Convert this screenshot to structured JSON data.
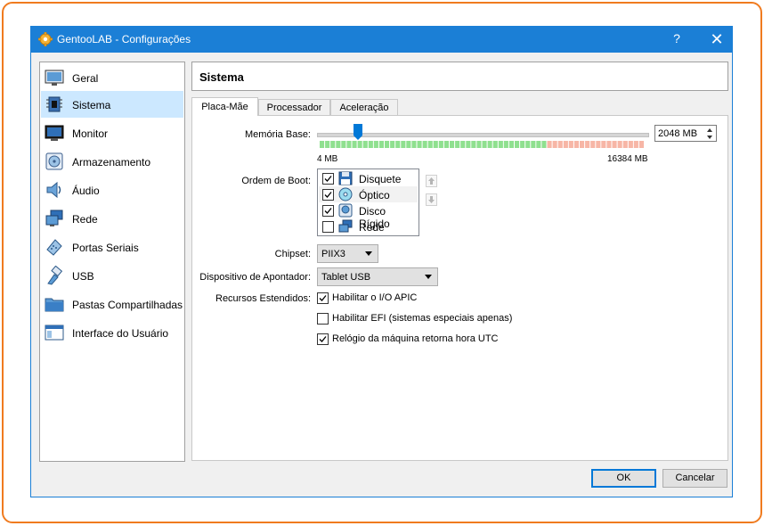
{
  "window": {
    "title": "GentooLAB - Configurações",
    "help_label": "?",
    "close_label": "✕"
  },
  "sidebar": {
    "items": [
      {
        "label": "Geral",
        "icon": "monitor-general-icon"
      },
      {
        "label": "Sistema",
        "icon": "chip-icon",
        "selected": true
      },
      {
        "label": "Monitor",
        "icon": "display-icon"
      },
      {
        "label": "Armazenamento",
        "icon": "disk-icon"
      },
      {
        "label": "Áudio",
        "icon": "speaker-icon"
      },
      {
        "label": "Rede",
        "icon": "network-icon"
      },
      {
        "label": "Portas Seriais",
        "icon": "serial-port-icon"
      },
      {
        "label": "USB",
        "icon": "usb-icon"
      },
      {
        "label": "Pastas Compartilhadas",
        "icon": "folder-icon"
      },
      {
        "label": "Interface do Usuário",
        "icon": "window-ui-icon"
      }
    ]
  },
  "header": {
    "title": "Sistema"
  },
  "tabs": [
    {
      "label": "Placa-Mãe",
      "active": true
    },
    {
      "label": "Processador"
    },
    {
      "label": "Aceleração"
    }
  ],
  "motherboard": {
    "memory_label": "Memória Base:",
    "memory_value": "2048 MB",
    "memory_min": "4 MB",
    "memory_max": "16384 MB",
    "memory_mb": 2048,
    "memory_max_mb": 16384,
    "boot_order_label": "Ordem de Boot:",
    "boot_items": [
      {
        "label": "Disquete",
        "checked": true,
        "icon": "floppy-icon"
      },
      {
        "label": "Óptico",
        "checked": true,
        "icon": "optical-disc-icon"
      },
      {
        "label": "Disco Rígido",
        "checked": true,
        "icon": "hard-disk-icon"
      },
      {
        "label": "Rede",
        "checked": false,
        "icon": "network-icon"
      }
    ],
    "chipset_label": "Chipset:",
    "chipset_value": "PIIX3",
    "pointing_label": "Dispositivo de Apontador:",
    "pointing_value": "Tablet USB",
    "extended_label": "Recursos Estendidos:",
    "extended": [
      {
        "label": "Habilitar o I/O APIC",
        "checked": true
      },
      {
        "label": "Habilitar EFI (sistemas especiais apenas)",
        "checked": false
      },
      {
        "label": "Relógio da máquina retorna hora UTC",
        "checked": true
      }
    ]
  },
  "buttons": {
    "ok": "OK",
    "cancel": "Cancelar"
  },
  "colors": {
    "accent": "#1b7fd6",
    "selection": "#cce8ff",
    "frame": "#f07b1f",
    "slider_ok": "#8fe08f",
    "slider_warn": "#f7b6a6"
  }
}
